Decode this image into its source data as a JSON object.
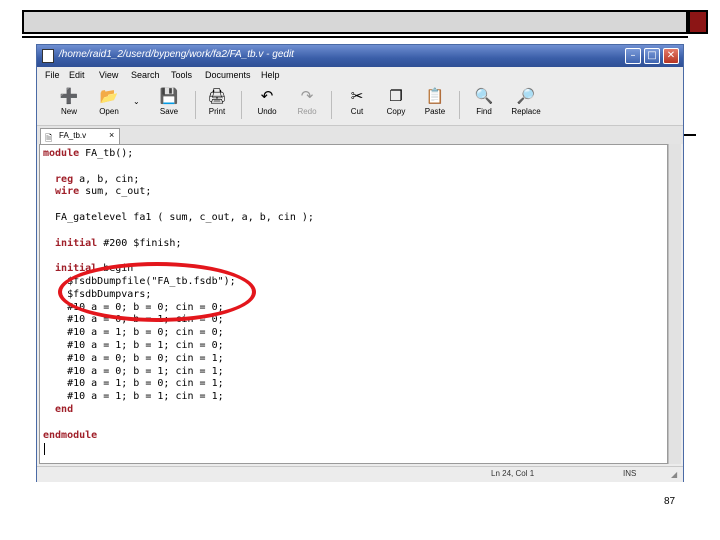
{
  "window": {
    "title": "/home/raid1_2/userd/bypeng/work/fa2/FA_tb.v - gedit"
  },
  "menu": [
    "File",
    "Edit",
    "View",
    "Search",
    "Tools",
    "Documents",
    "Help"
  ],
  "toolbar": [
    {
      "label": "New",
      "icon": "new-document-icon",
      "glyph": "➕"
    },
    {
      "label": "Open",
      "icon": "folder-open-icon",
      "glyph": "📂"
    },
    {
      "label": "Save",
      "icon": "floppy-disk-icon",
      "glyph": "💾"
    },
    {
      "label": "Print",
      "icon": "printer-icon",
      "glyph": "🖨"
    },
    {
      "label": "Undo",
      "icon": "undo-icon",
      "glyph": "↶"
    },
    {
      "label": "Redo",
      "icon": "redo-icon",
      "glyph": "↷"
    },
    {
      "label": "Cut",
      "icon": "scissors-icon",
      "glyph": "✂"
    },
    {
      "label": "Copy",
      "icon": "copy-icon",
      "glyph": "❐"
    },
    {
      "label": "Paste",
      "icon": "clipboard-icon",
      "glyph": "📋"
    },
    {
      "label": "Find",
      "icon": "magnifier-icon",
      "glyph": "🔍"
    },
    {
      "label": "Replace",
      "icon": "replace-icon",
      "glyph": "🔎"
    }
  ],
  "tab": {
    "label": "FA_tb.v",
    "close": "×"
  },
  "code": [
    {
      "kw": "module",
      "text": " FA_tb();"
    },
    {
      "kw": "",
      "text": ""
    },
    {
      "kw": "  reg",
      "text": " a, b, cin;"
    },
    {
      "kw": "  wire",
      "text": " sum, c_out;"
    },
    {
      "kw": "",
      "text": ""
    },
    {
      "kw": "",
      "text": "  FA_gatelevel fa1 ( sum, c_out, a, b, cin );"
    },
    {
      "kw": "",
      "text": ""
    },
    {
      "kw": "  initial",
      "text": " #200 $finish;"
    },
    {
      "kw": "",
      "text": ""
    },
    {
      "kw": "  initial",
      "text": " begin"
    },
    {
      "kw": "",
      "text": "    $fsdbDumpfile(\"FA_tb.fsdb\");"
    },
    {
      "kw": "",
      "text": "    $fsdbDumpvars;"
    },
    {
      "kw": "",
      "text": "    #10 a = 0; b = 0; cin = 0;"
    },
    {
      "kw": "",
      "text": "    #10 a = 0; b = 1; cin = 0;"
    },
    {
      "kw": "",
      "text": "    #10 a = 1; b = 0; cin = 0;"
    },
    {
      "kw": "",
      "text": "    #10 a = 1; b = 1; cin = 0;"
    },
    {
      "kw": "",
      "text": "    #10 a = 0; b = 0; cin = 1;"
    },
    {
      "kw": "",
      "text": "    #10 a = 0; b = 1; cin = 1;"
    },
    {
      "kw": "",
      "text": "    #10 a = 1; b = 0; cin = 1;"
    },
    {
      "kw": "",
      "text": "    #10 a = 1; b = 1; cin = 1;"
    },
    {
      "kw": "  end",
      "text": ""
    },
    {
      "kw": "",
      "text": ""
    },
    {
      "kw": "endmodule",
      "text": ""
    }
  ],
  "status": {
    "position": "Ln 24, Col 1",
    "mode": "INS"
  },
  "page_number": "87",
  "colors": {
    "keyword": "#a0202a",
    "annotation": "#e3161c",
    "titlebar": "#3a5ea8"
  }
}
